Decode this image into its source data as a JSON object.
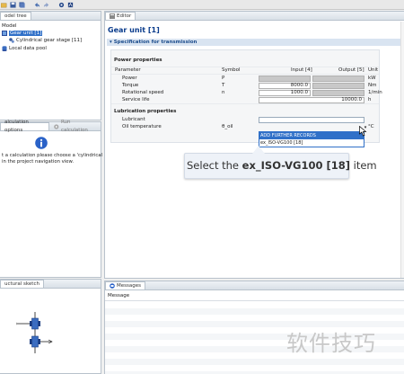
{
  "tree_panel": {
    "tab_label": "Model tree",
    "tab_visible": "odel tree"
  },
  "tree": {
    "root": "Model",
    "gear_unit": "Gear unit [1]",
    "gear_stage": "Cylindrical gear stage [11]",
    "local_pool": "Local data pool"
  },
  "calc_panel": {
    "tab_options": "alculation options",
    "tab_run": "Run calculation",
    "message_line1": "t a calculation please choose a 'cylindrical",
    "message_line2": "in the project navigation view."
  },
  "sketch_panel": {
    "tab": "uctural sketch"
  },
  "editor": {
    "tab": "Editor",
    "title": "Gear unit [1]",
    "section": "Specification for transmission",
    "power_heading": "Power properties",
    "columns": {
      "parameter": "Parameter",
      "symbol": "Symbol",
      "input": "Input [4]",
      "output": "Output [5]",
      "unit": "Unit"
    },
    "rows": [
      {
        "parameter": "Power",
        "symbol": "P",
        "input": "",
        "output": "",
        "unit": "kW"
      },
      {
        "parameter": "Torque",
        "symbol": "T",
        "input": "8000.0",
        "output": "",
        "unit": "Nm"
      },
      {
        "parameter": "Rotational speed",
        "symbol": "n",
        "input": "1000.0",
        "output": "",
        "unit": "1/min"
      },
      {
        "parameter": "Service life",
        "symbol": "",
        "input": "",
        "output": "10000.0",
        "unit": "h"
      }
    ],
    "lube_heading": "Lubrication properties",
    "lubricant_label": "Lubricant",
    "oil_temp_label": "Oil temperature",
    "oil_temp_symbol": "θ_oil",
    "oil_temp_unit": "°C",
    "dropdown_options": [
      "ADD FURTHER RECORDS",
      "ex_ISO-VG100 [18]"
    ]
  },
  "callout": {
    "prefix": "Select the ",
    "bold": "ex_ISO-VG100 [18]",
    "suffix": " item"
  },
  "messages": {
    "tab": "Messages",
    "column": "Message"
  },
  "watermark": "软件技巧"
}
